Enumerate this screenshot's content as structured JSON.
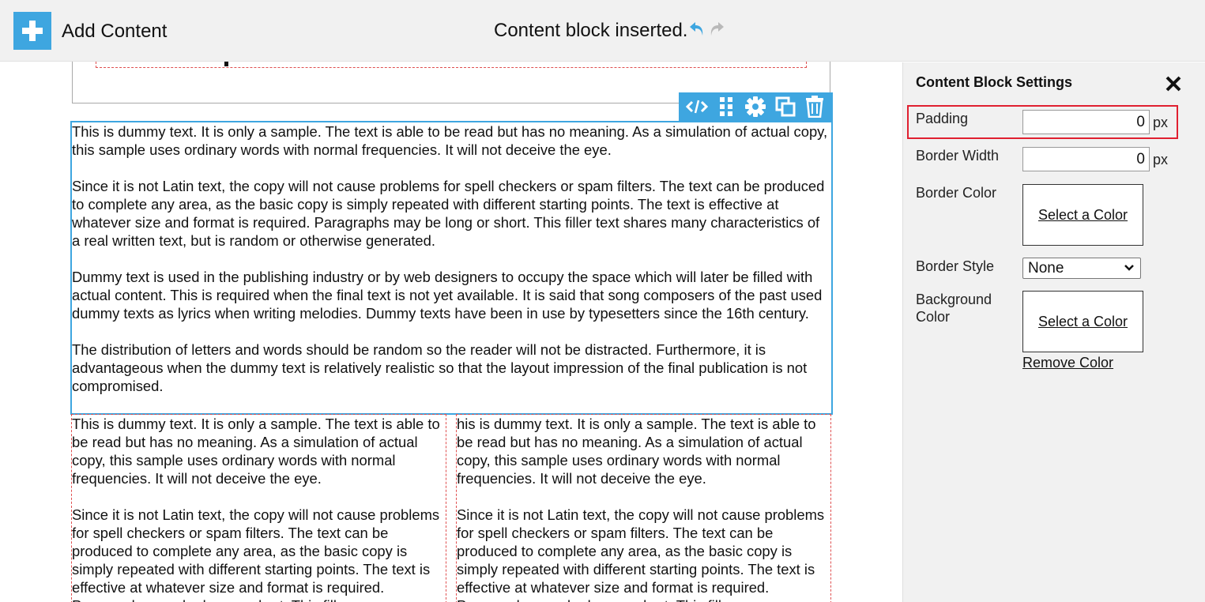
{
  "header": {
    "add_label": "Add Content",
    "status_text": "Content block inserted."
  },
  "block": {
    "paragraphs": [
      "This is dummy text. It is only a sample. The text is able to be read but has no meaning. As a simulation of actual copy, this sample uses ordinary words with normal frequencies. It will not deceive the eye.",
      "Since it is not Latin text, the copy will not cause problems for spell checkers or spam filters. The text can be produced to complete any area, as the basic copy is simply repeated with different starting points. The text is effective at whatever size and format is required. Paragraphs may be long or short. This filler text shares many characteristics of a real written text, but is random or otherwise generated.",
      "Dummy text is used in the publishing industry or by web designers to occupy the space which will later be filled with actual content. This is required when the final text is not yet available. It is said that song composers of the past used dummy texts as lyrics when writing melodies. Dummy texts have been in use by typesetters since the 16th century.",
      "The distribution of letters and words should be random so the reader will not be distracted. Furthermore, it is advantageous when the dummy text is relatively realistic so that the layout impression of the final publication is not compromised."
    ]
  },
  "columns": {
    "left": [
      "This is dummy text. It is only a sample. The text is able to be read but has no meaning. As a simulation of actual copy, this sample uses ordinary words with normal frequencies. It will not deceive the eye.",
      "Since it is not Latin text, the copy will not cause problems for spell checkers or spam filters. The text can be produced to complete any area, as the basic copy is simply repeated with different starting points. The text is effective at whatever size and format is required. Paragraphs may be long or short. This filler"
    ],
    "right": [
      "his is dummy text. It is only a sample. The text is able to be read but has no meaning. As a simulation of actual copy, this sample uses ordinary words with normal frequencies. It will not deceive the eye.",
      "Since it is not Latin text, the copy will not cause problems for spell checkers or spam filters. The text can be produced to complete any area, as the basic copy is simply repeated with different starting points. The text is effective at whatever size and format is required. Paragraphs may be long or short. This filler"
    ]
  },
  "settings": {
    "title": "Content Block Settings",
    "padding_label": "Padding",
    "padding_value": "0",
    "border_width_label": "Border Width",
    "border_width_value": "0",
    "unit": "px",
    "border_color_label": "Border Color",
    "select_color": "Select a Color",
    "border_style_label": "Border Style",
    "border_style_value": "None",
    "background_color_label": "Background Color",
    "remove_color": "Remove Color"
  },
  "icons": {
    "add": "plus-icon",
    "undo": "undo-icon",
    "redo": "redo-icon",
    "toolbar": [
      "code-icon",
      "drag-handle-icon",
      "gear-icon",
      "duplicate-icon",
      "trash-icon"
    ],
    "close": "close-icon",
    "dropdown": "chevron-down-icon"
  },
  "colors": {
    "accent": "#3ea6e0",
    "highlight": "#e02030",
    "guide": "#e05050",
    "panel_bg": "#f1f1f1"
  }
}
